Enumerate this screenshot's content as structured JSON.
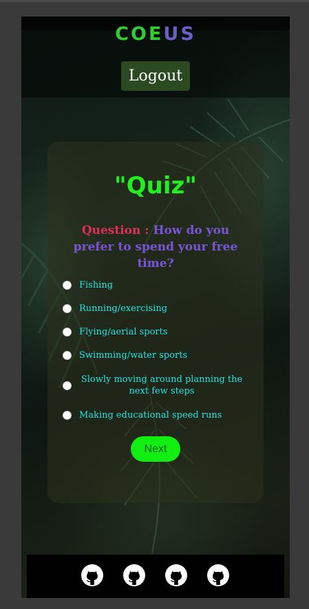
{
  "header": {
    "brand_part1": "COE",
    "brand_part2": "US",
    "logout_label": "Logout"
  },
  "quiz": {
    "title": "\"Quiz\"",
    "question_prefix": "Question : ",
    "question_text": "How do you prefer to spend your free time?",
    "options": [
      "Fishing",
      "Running/exercising",
      "Flying/aerial sports",
      "Swimming/water sports",
      "Slowly moving around planning the next few steps",
      "Making educational speed runs"
    ],
    "next_label": "Next"
  },
  "footer": {
    "icons": [
      "github-icon",
      "github-icon",
      "github-icon",
      "github-icon"
    ]
  },
  "colors": {
    "brand_green": "#33cc33",
    "brand_purple": "#6a5fc8",
    "title_green": "#22ee22",
    "question_prefix": "#e0305a",
    "question_text": "#7a55d8",
    "option_text": "#1fe5e5",
    "next_button": "#11ee11",
    "logout_button": "#2b4a22"
  }
}
